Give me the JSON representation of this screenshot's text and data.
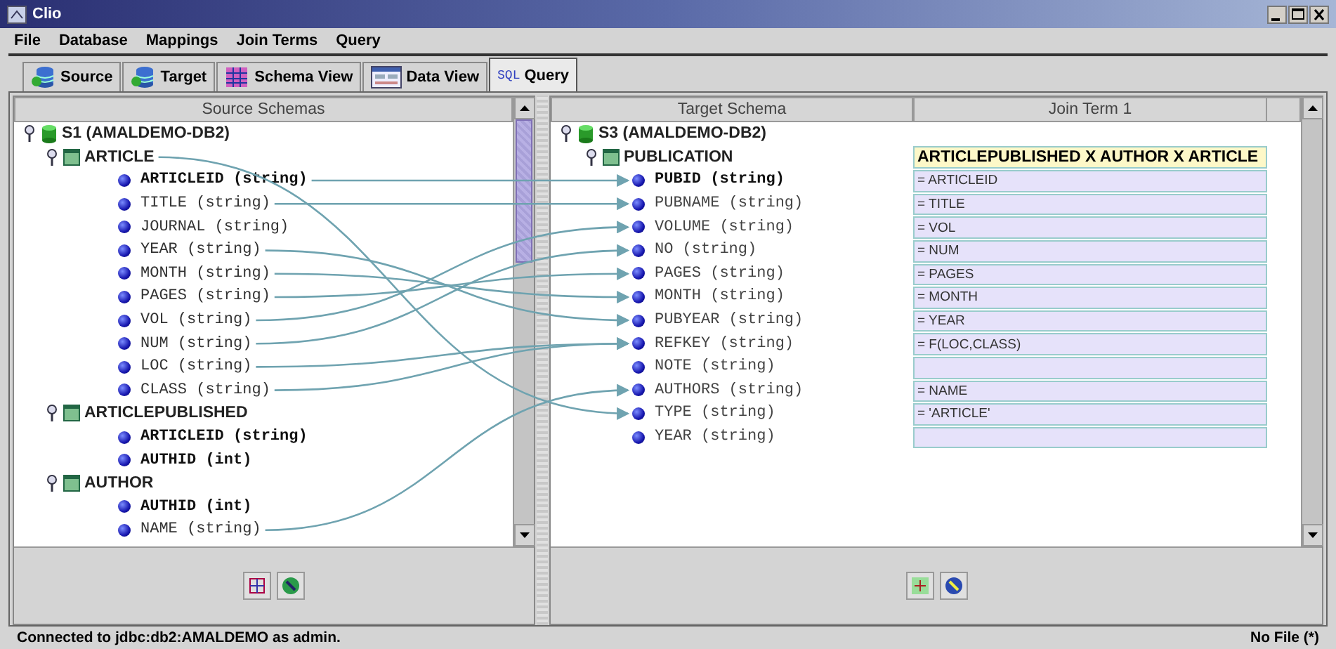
{
  "window": {
    "title": "Clio"
  },
  "menu": [
    "File",
    "Database",
    "Mappings",
    "Join Terms",
    "Query"
  ],
  "tabs": [
    {
      "label": "Source",
      "selected": false
    },
    {
      "label": "Target",
      "selected": false
    },
    {
      "label": "Schema View",
      "selected": false
    },
    {
      "label": "Data View",
      "selected": false
    },
    {
      "label": "Query",
      "icon_text": "SQL",
      "selected": true
    }
  ],
  "source": {
    "header": "Source Schemas",
    "schema": "S1 (AMALDEMO-DB2)",
    "tables": [
      {
        "name": "ARTICLE",
        "expanded": true,
        "fields": [
          {
            "name": "ARTICLEID (string)",
            "key": true
          },
          {
            "name": "TITLE (string)",
            "key": false
          },
          {
            "name": "JOURNAL (string)",
            "key": false
          },
          {
            "name": "YEAR (string)",
            "key": false
          },
          {
            "name": "MONTH (string)",
            "key": false
          },
          {
            "name": "PAGES (string)",
            "key": false
          },
          {
            "name": "VOL (string)",
            "key": false
          },
          {
            "name": "NUM (string)",
            "key": false
          },
          {
            "name": "LOC (string)",
            "key": false
          },
          {
            "name": "CLASS (string)",
            "key": false
          }
        ]
      },
      {
        "name": "ARTICLEPUBLISHED",
        "expanded": true,
        "fields": [
          {
            "name": "ARTICLEID (string)",
            "key": true
          },
          {
            "name": "AUTHID (int)",
            "key": true
          }
        ]
      },
      {
        "name": "AUTHOR",
        "expanded": true,
        "fields": [
          {
            "name": "AUTHID (int)",
            "key": true
          },
          {
            "name": "NAME (string)",
            "key": false
          }
        ]
      }
    ]
  },
  "target": {
    "header": "Target Schema",
    "join_header": "Join Term 1",
    "schema": "S3 (AMALDEMO-DB2)",
    "table": "PUBLICATION",
    "join_title": "ARTICLEPUBLISHED X AUTHOR X ARTICLE",
    "fields": [
      {
        "name": "PUBID (string)",
        "key": true,
        "join": "= ARTICLEID"
      },
      {
        "name": "PUBNAME (string)",
        "key": false,
        "join": "= TITLE"
      },
      {
        "name": "VOLUME (string)",
        "key": false,
        "join": "= VOL"
      },
      {
        "name": "NO (string)",
        "key": false,
        "join": "= NUM"
      },
      {
        "name": "PAGES (string)",
        "key": false,
        "join": "= PAGES"
      },
      {
        "name": "MONTH (string)",
        "key": false,
        "join": "= MONTH"
      },
      {
        "name": "PUBYEAR (string)",
        "key": false,
        "join": "= YEAR"
      },
      {
        "name": "REFKEY (string)",
        "key": false,
        "join": "= F(LOC,CLASS)"
      },
      {
        "name": "NOTE (string)",
        "key": false
      },
      {
        "name": "AUTHORS (string)",
        "key": false,
        "join": "= NAME"
      },
      {
        "name": "TYPE (string)",
        "key": false,
        "join": "= 'ARTICLE'"
      },
      {
        "name": "YEAR (string)",
        "key": false
      }
    ]
  },
  "status_bar": {
    "left": "Connected to jdbc:db2:AMALDEMO as admin.",
    "right": "No File (*)"
  }
}
